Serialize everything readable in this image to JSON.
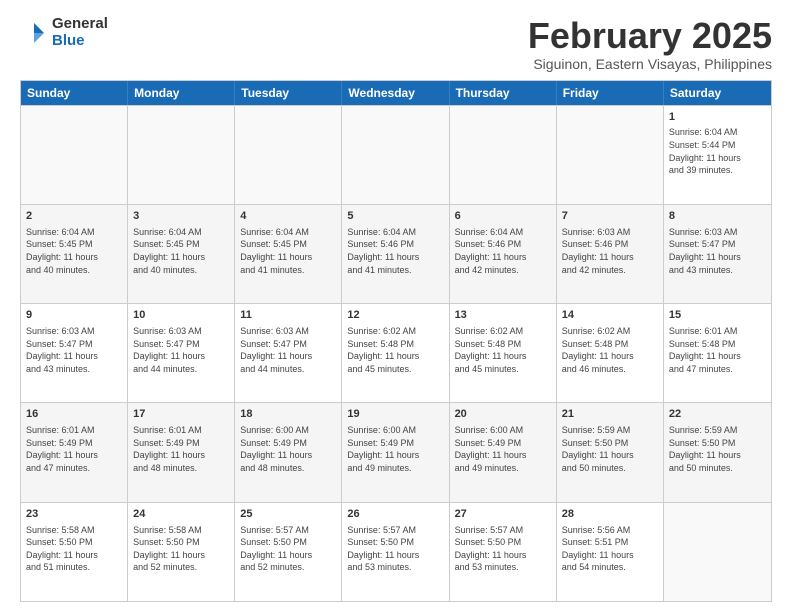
{
  "logo": {
    "general": "General",
    "blue": "Blue"
  },
  "header": {
    "month": "February 2025",
    "location": "Siguinon, Eastern Visayas, Philippines"
  },
  "weekdays": [
    "Sunday",
    "Monday",
    "Tuesday",
    "Wednesday",
    "Thursday",
    "Friday",
    "Saturday"
  ],
  "rows": [
    [
      {
        "day": "",
        "info": ""
      },
      {
        "day": "",
        "info": ""
      },
      {
        "day": "",
        "info": ""
      },
      {
        "day": "",
        "info": ""
      },
      {
        "day": "",
        "info": ""
      },
      {
        "day": "",
        "info": ""
      },
      {
        "day": "1",
        "info": "Sunrise: 6:04 AM\nSunset: 5:44 PM\nDaylight: 11 hours\nand 39 minutes."
      }
    ],
    [
      {
        "day": "2",
        "info": "Sunrise: 6:04 AM\nSunset: 5:45 PM\nDaylight: 11 hours\nand 40 minutes."
      },
      {
        "day": "3",
        "info": "Sunrise: 6:04 AM\nSunset: 5:45 PM\nDaylight: 11 hours\nand 40 minutes."
      },
      {
        "day": "4",
        "info": "Sunrise: 6:04 AM\nSunset: 5:45 PM\nDaylight: 11 hours\nand 41 minutes."
      },
      {
        "day": "5",
        "info": "Sunrise: 6:04 AM\nSunset: 5:46 PM\nDaylight: 11 hours\nand 41 minutes."
      },
      {
        "day": "6",
        "info": "Sunrise: 6:04 AM\nSunset: 5:46 PM\nDaylight: 11 hours\nand 42 minutes."
      },
      {
        "day": "7",
        "info": "Sunrise: 6:03 AM\nSunset: 5:46 PM\nDaylight: 11 hours\nand 42 minutes."
      },
      {
        "day": "8",
        "info": "Sunrise: 6:03 AM\nSunset: 5:47 PM\nDaylight: 11 hours\nand 43 minutes."
      }
    ],
    [
      {
        "day": "9",
        "info": "Sunrise: 6:03 AM\nSunset: 5:47 PM\nDaylight: 11 hours\nand 43 minutes."
      },
      {
        "day": "10",
        "info": "Sunrise: 6:03 AM\nSunset: 5:47 PM\nDaylight: 11 hours\nand 44 minutes."
      },
      {
        "day": "11",
        "info": "Sunrise: 6:03 AM\nSunset: 5:47 PM\nDaylight: 11 hours\nand 44 minutes."
      },
      {
        "day": "12",
        "info": "Sunrise: 6:02 AM\nSunset: 5:48 PM\nDaylight: 11 hours\nand 45 minutes."
      },
      {
        "day": "13",
        "info": "Sunrise: 6:02 AM\nSunset: 5:48 PM\nDaylight: 11 hours\nand 45 minutes."
      },
      {
        "day": "14",
        "info": "Sunrise: 6:02 AM\nSunset: 5:48 PM\nDaylight: 11 hours\nand 46 minutes."
      },
      {
        "day": "15",
        "info": "Sunrise: 6:01 AM\nSunset: 5:48 PM\nDaylight: 11 hours\nand 47 minutes."
      }
    ],
    [
      {
        "day": "16",
        "info": "Sunrise: 6:01 AM\nSunset: 5:49 PM\nDaylight: 11 hours\nand 47 minutes."
      },
      {
        "day": "17",
        "info": "Sunrise: 6:01 AM\nSunset: 5:49 PM\nDaylight: 11 hours\nand 48 minutes."
      },
      {
        "day": "18",
        "info": "Sunrise: 6:00 AM\nSunset: 5:49 PM\nDaylight: 11 hours\nand 48 minutes."
      },
      {
        "day": "19",
        "info": "Sunrise: 6:00 AM\nSunset: 5:49 PM\nDaylight: 11 hours\nand 49 minutes."
      },
      {
        "day": "20",
        "info": "Sunrise: 6:00 AM\nSunset: 5:49 PM\nDaylight: 11 hours\nand 49 minutes."
      },
      {
        "day": "21",
        "info": "Sunrise: 5:59 AM\nSunset: 5:50 PM\nDaylight: 11 hours\nand 50 minutes."
      },
      {
        "day": "22",
        "info": "Sunrise: 5:59 AM\nSunset: 5:50 PM\nDaylight: 11 hours\nand 50 minutes."
      }
    ],
    [
      {
        "day": "23",
        "info": "Sunrise: 5:58 AM\nSunset: 5:50 PM\nDaylight: 11 hours\nand 51 minutes."
      },
      {
        "day": "24",
        "info": "Sunrise: 5:58 AM\nSunset: 5:50 PM\nDaylight: 11 hours\nand 52 minutes."
      },
      {
        "day": "25",
        "info": "Sunrise: 5:57 AM\nSunset: 5:50 PM\nDaylight: 11 hours\nand 52 minutes."
      },
      {
        "day": "26",
        "info": "Sunrise: 5:57 AM\nSunset: 5:50 PM\nDaylight: 11 hours\nand 53 minutes."
      },
      {
        "day": "27",
        "info": "Sunrise: 5:57 AM\nSunset: 5:50 PM\nDaylight: 11 hours\nand 53 minutes."
      },
      {
        "day": "28",
        "info": "Sunrise: 5:56 AM\nSunset: 5:51 PM\nDaylight: 11 hours\nand 54 minutes."
      },
      {
        "day": "",
        "info": ""
      }
    ]
  ]
}
